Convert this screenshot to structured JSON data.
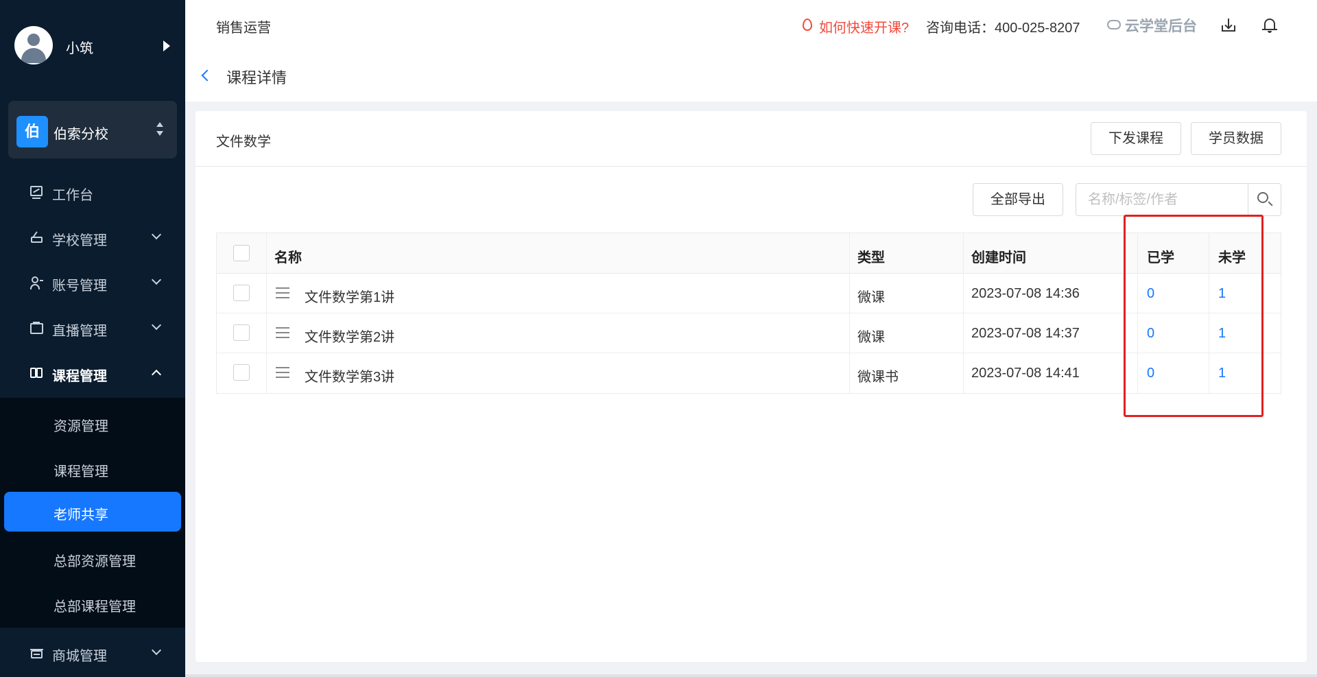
{
  "user": {
    "name": "小筑"
  },
  "school": {
    "badge": "伯",
    "name": "伯索分校"
  },
  "nav": [
    {
      "label": "工作台",
      "icon": "dashboard-icon"
    },
    {
      "label": "学校管理",
      "icon": "school-icon"
    },
    {
      "label": "账号管理",
      "icon": "users-icon"
    },
    {
      "label": "直播管理",
      "icon": "live-icon"
    },
    {
      "label": "课程管理",
      "icon": "book-icon"
    },
    {
      "label": "商城管理",
      "icon": "store-icon"
    }
  ],
  "submenu": [
    "资源管理",
    "课程管理",
    "老师共享",
    "总部资源管理",
    "总部课程管理"
  ],
  "header": {
    "title": "销售运营",
    "quick_link": "如何快速开课?",
    "phone": "咨询电话：400-025-8207",
    "brand": "云学堂后台"
  },
  "breadcrumb": {
    "title": "课程详情"
  },
  "card": {
    "title": "文件数学",
    "issue_button": "下发课程",
    "students_button": "学员数据",
    "export_button": "全部导出",
    "search_placeholder": "名称/标签/作者"
  },
  "table": {
    "headers": {
      "name": "名称",
      "type": "类型",
      "created": "创建时间",
      "learned": "已学",
      "unlearned": "未学"
    },
    "rows": [
      {
        "name": "文件数学第1讲",
        "type": "微课",
        "created": "2023-07-08 14:36",
        "learned": "0",
        "unlearned": "1"
      },
      {
        "name": "文件数学第2讲",
        "type": "微课",
        "created": "2023-07-08 14:37",
        "learned": "0",
        "unlearned": "1"
      },
      {
        "name": "文件数学第3讲",
        "type": "微课书",
        "created": "2023-07-08 14:41",
        "learned": "0",
        "unlearned": "1"
      }
    ]
  },
  "colors": {
    "accent": "#1677ff",
    "sidebar": "#0a1c2e",
    "warning": "#f5483b",
    "highlight": "#e02020"
  }
}
